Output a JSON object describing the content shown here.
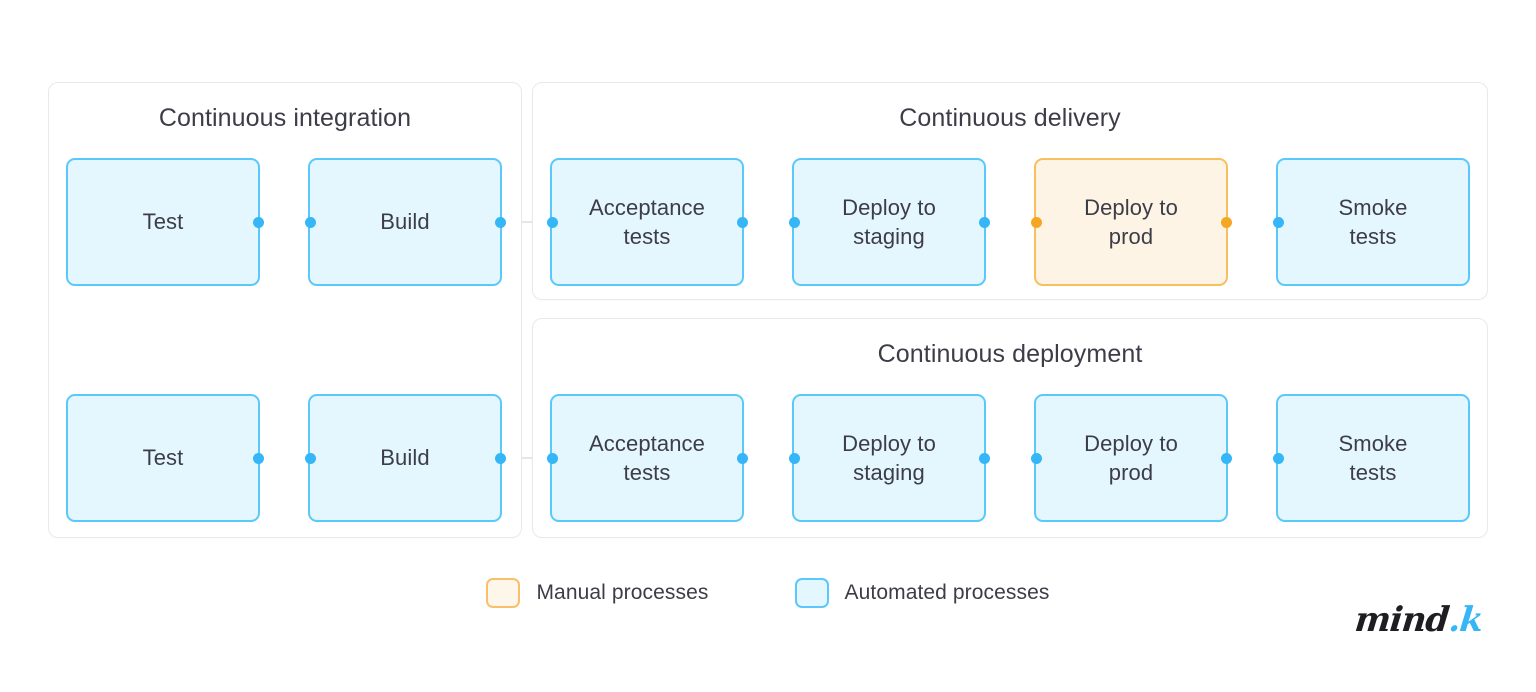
{
  "diagram": {
    "title_ci": "Continuous integration",
    "title_cd": "Continuous delivery",
    "title_cdep": "Continuous deployment"
  },
  "colors": {
    "automated_fill": "#e4f6fe",
    "automated_border": "#5ac8fa",
    "automated_dot": "#35b6f6",
    "manual_fill": "#fdf4e5",
    "manual_border": "#f8bf5e",
    "manual_dot": "#f5a623",
    "panel_border": "#e9e9e9",
    "text": "#3d3d47",
    "connector_line": "#e6e6e6",
    "logo_dark": "#1d1d22",
    "logo_blue": "#35b6f6"
  },
  "rows": [
    {
      "name": "delivery-row",
      "ci_nodes": [
        {
          "label": "Test",
          "type": "automated",
          "dot_left": false,
          "dot_right": true
        },
        {
          "label": "Build",
          "type": "automated",
          "dot_left": true,
          "dot_right": true
        }
      ],
      "pipeline_nodes": [
        {
          "label": "Acceptance\ntests",
          "type": "automated",
          "dot_left": true,
          "dot_right": true
        },
        {
          "label": "Deploy to\nstaging",
          "type": "automated",
          "dot_left": true,
          "dot_right": true
        },
        {
          "label": "Deploy to\nprod",
          "type": "manual",
          "dot_left": true,
          "dot_right": true
        },
        {
          "label": "Smoke\ntests",
          "type": "automated",
          "dot_left": true,
          "dot_right": false
        }
      ]
    },
    {
      "name": "deployment-row",
      "ci_nodes": [
        {
          "label": "Test",
          "type": "automated",
          "dot_left": false,
          "dot_right": true
        },
        {
          "label": "Build",
          "type": "automated",
          "dot_left": true,
          "dot_right": true
        }
      ],
      "pipeline_nodes": [
        {
          "label": "Acceptance\ntests",
          "type": "automated",
          "dot_left": true,
          "dot_right": true
        },
        {
          "label": "Deploy to\nstaging",
          "type": "automated",
          "dot_left": true,
          "dot_right": true
        },
        {
          "label": "Deploy to\nprod",
          "type": "automated",
          "dot_left": true,
          "dot_right": true
        },
        {
          "label": "Smoke\ntests",
          "type": "automated",
          "dot_left": true,
          "dot_right": false
        }
      ]
    }
  ],
  "legend": [
    {
      "label": "Manual processes",
      "type": "manual"
    },
    {
      "label": "Automated processes",
      "type": "automated"
    }
  ],
  "logo": {
    "primary": "mind",
    "accent": ".k"
  }
}
